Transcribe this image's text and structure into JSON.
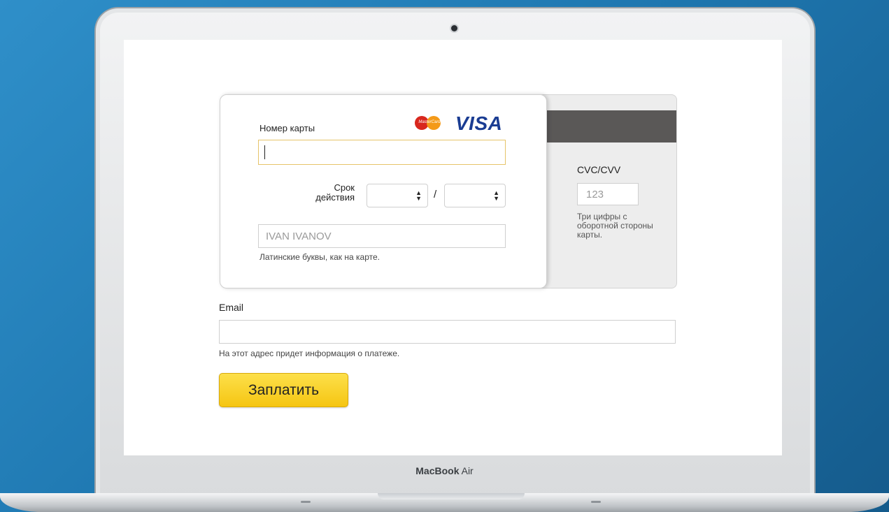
{
  "device": {
    "brand_bold": "MacBook",
    "brand_light": "Air"
  },
  "card_front": {
    "number_label": "Номер карты",
    "number_value": "",
    "mastercard_text": "MasterCard",
    "visa_text": "VISA",
    "expiry_label_line1": "Срок",
    "expiry_label_line2": "действия",
    "expiry_separator": "/",
    "name_placeholder": "IVAN IVANOV",
    "name_hint": "Латинские буквы, как на карте."
  },
  "card_back": {
    "cvc_label": "CVC/CVV",
    "cvc_placeholder": "123",
    "cvc_hint": "Три цифры с оборотной стороны карты."
  },
  "email": {
    "label": "Email",
    "value": "",
    "hint": "На этот адрес придет информация о платеже."
  },
  "pay_button_label": "Заплатить",
  "colors": {
    "accent_button": "#f8d22a",
    "visa_blue": "#1a3c92",
    "mastercard_red": "#d8271e",
    "mastercard_orange": "#f49a18"
  }
}
